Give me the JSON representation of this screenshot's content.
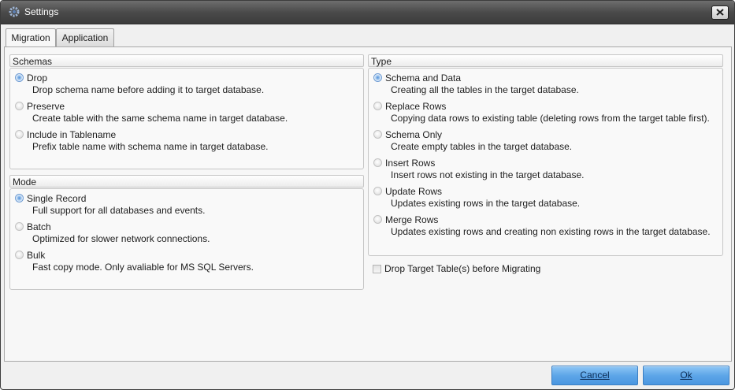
{
  "window": {
    "title": "Settings"
  },
  "tabs": [
    {
      "label": "Migration",
      "active": true
    },
    {
      "label": "Application",
      "active": false
    }
  ],
  "schemas": {
    "title": "Schemas",
    "options": [
      {
        "label": "Drop",
        "description": "Drop schema name before adding it to target database.",
        "checked": true
      },
      {
        "label": "Preserve",
        "description": "Create table with the same schema name in target database.",
        "checked": false
      },
      {
        "label": "Include in Tablename",
        "description": "Prefix table name with schema name in target database.",
        "checked": false
      }
    ]
  },
  "mode": {
    "title": "Mode",
    "options": [
      {
        "label": "Single Record",
        "description": "Full support for all databases and events.",
        "checked": true
      },
      {
        "label": "Batch",
        "description": "Optimized for slower network connections.",
        "checked": false
      },
      {
        "label": "Bulk",
        "description": "Fast copy mode. Only avaliable for MS SQL Servers.",
        "checked": false
      }
    ]
  },
  "type": {
    "title": "Type",
    "options": [
      {
        "label": "Schema and Data",
        "description": "Creating all the tables in the target database.",
        "checked": true
      },
      {
        "label": "Replace Rows",
        "description": "Copying data rows to existing table (deleting rows from the target table first).",
        "checked": false
      },
      {
        "label": "Schema Only",
        "description": "Create empty tables in the target database.",
        "checked": false
      },
      {
        "label": "Insert Rows",
        "description": "Insert rows not existing in the target database.",
        "checked": false
      },
      {
        "label": "Update Rows",
        "description": "Updates existing rows in the target database.",
        "checked": false
      },
      {
        "label": "Merge Rows",
        "description": "Updates existing rows and creating non existing rows in the target database.",
        "checked": false
      }
    ]
  },
  "drop_tables": {
    "label": "Drop Target Table(s) before Migrating",
    "checked": false
  },
  "buttons": {
    "cancel": "Cancel",
    "ok": "Ok"
  },
  "colors": {
    "accent": "#5ea6e8",
    "titlebar": "#4a4a4a"
  }
}
